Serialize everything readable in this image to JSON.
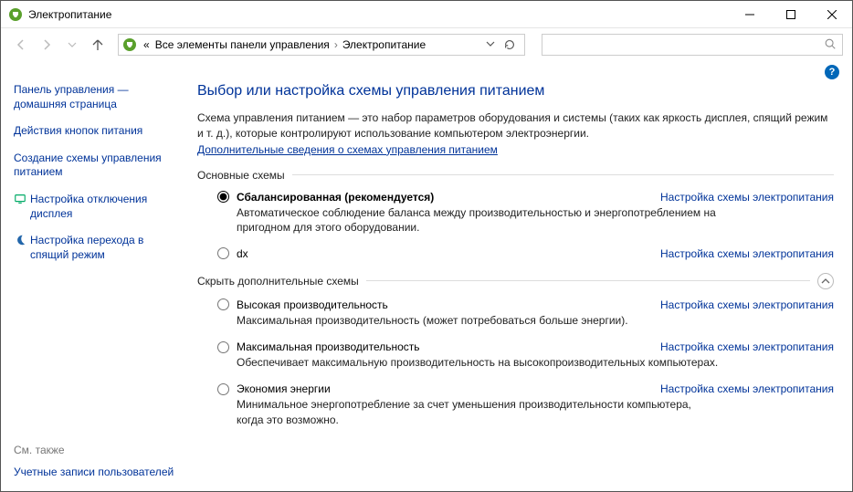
{
  "window": {
    "title": "Электропитание"
  },
  "breadcrumb": {
    "item1": "Все элементы панели управления",
    "item2": "Электропитание",
    "leading": "«"
  },
  "search": {
    "placeholder": ""
  },
  "help": {
    "symbol": "?"
  },
  "sidebar": {
    "home": "Панель управления — домашняя страница",
    "links": {
      "0": "Действия кнопок питания",
      "1": "Создание схемы управления питанием",
      "2": "Настройка отключения дисплея",
      "3": "Настройка перехода в спящий режим"
    },
    "see_also_heading": "См. также",
    "see_also_link": "Учетные записи пользователей"
  },
  "main": {
    "title": "Выбор или настройка схемы управления питанием",
    "desc": "Схема управления питанием — это набор параметров оборудования и системы (таких как яркость дисплея, спящий режим и т. д.), которые контролируют использование компьютером электроэнергии.",
    "more_link": "Дополнительные сведения о схемах управления питанием",
    "section_basic": "Основные схемы",
    "section_extra": "Скрыть дополнительные схемы",
    "plan_settings_link": "Настройка схемы электропитания",
    "plans": {
      "balanced": {
        "name": "Сбалансированная (рекомендуется)",
        "desc": "Автоматическое соблюдение баланса между производительностью и энергопотреблением на пригодном для этого оборудовании."
      },
      "dx": {
        "name": "dx"
      },
      "high": {
        "name": "Высокая производительность",
        "desc": "Максимальная производительность (может потребоваться больше энергии)."
      },
      "max": {
        "name": "Максимальная производительность",
        "desc": "Обеспечивает максимальную производительность на высокопроизводительных компьютерах."
      },
      "eco": {
        "name": "Экономия энергии",
        "desc": "Минимальное энергопотребление за счет уменьшения производительности компьютера, когда это возможно."
      }
    }
  }
}
